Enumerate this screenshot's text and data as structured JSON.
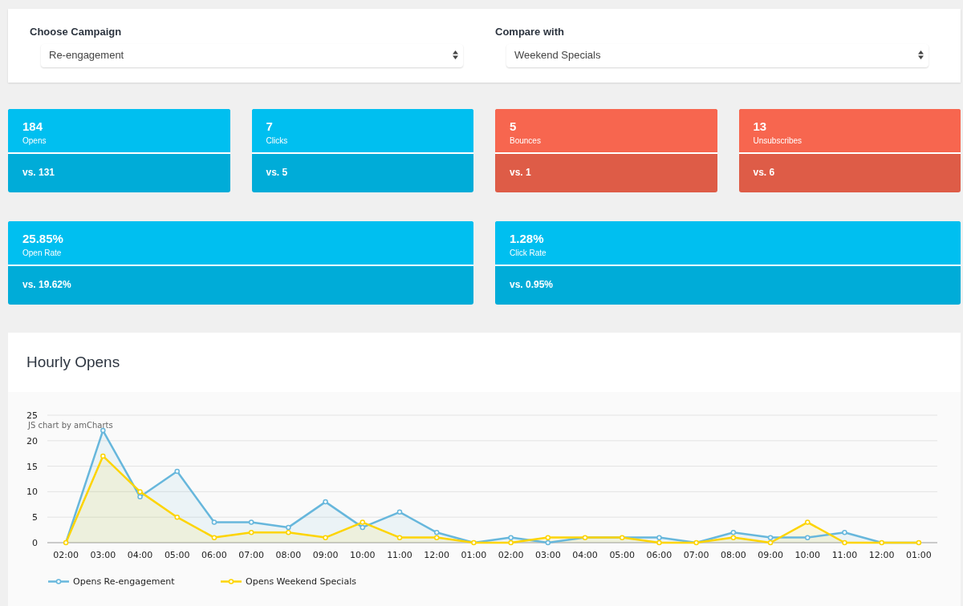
{
  "filters": [
    {
      "label": "Choose Campaign",
      "value": "Re-engagement"
    },
    {
      "label": "Compare with",
      "value": "Weekend Specials"
    }
  ],
  "stat_rows": [
    {
      "cards": [
        {
          "value": "184",
          "label": "Opens",
          "comparison": "vs. 131",
          "color": "#00bff0"
        },
        {
          "value": "7",
          "label": "Clicks",
          "comparison": "vs. 5",
          "color": "#00bff0"
        },
        {
          "value": "5",
          "label": "Bounces",
          "comparison": "vs. 1",
          "color": "#f7664f"
        },
        {
          "value": "13",
          "label": "Unsubscribes",
          "comparison": "vs. 6",
          "color": "#f7664f"
        }
      ]
    },
    {
      "cards": [
        {
          "value": "25.85%",
          "label": "Open Rate",
          "comparison": "vs. 19.62%",
          "color": "#00bff0"
        },
        {
          "value": "1.28%",
          "label": "Click Rate",
          "comparison": "vs. 0.95%",
          "color": "#00bff0"
        }
      ]
    }
  ],
  "chart_panel": {
    "title": "Hourly Opens",
    "credit": "JS chart by amCharts",
    "chart_data": {
      "type": "area",
      "categories": [
        "02:00",
        "03:00",
        "04:00",
        "05:00",
        "06:00",
        "07:00",
        "08:00",
        "09:00",
        "10:00",
        "11:00",
        "12:00",
        "01:00",
        "02:00",
        "03:00",
        "04:00",
        "05:00",
        "06:00",
        "07:00",
        "08:00",
        "09:00",
        "10:00",
        "11:00",
        "12:00",
        "01:00"
      ],
      "series": [
        {
          "name": "Opens Re-engagement",
          "color": "#67b7dc",
          "values": [
            0,
            22,
            9,
            14,
            4,
            4,
            3,
            8,
            3,
            6,
            2,
            0,
            1,
            0,
            1,
            1,
            1,
            0,
            2,
            1,
            1,
            2,
            0,
            0
          ]
        },
        {
          "name": "Opens Weekend Specials",
          "color": "#fdd400",
          "values": [
            0,
            17,
            10,
            5,
            1,
            2,
            2,
            1,
            4,
            1,
            1,
            0,
            0,
            1,
            1,
            1,
            0,
            0,
            1,
            0,
            4,
            0,
            0,
            0
          ]
        }
      ],
      "ylim": [
        0,
        25
      ],
      "yticks": [
        0,
        5,
        10,
        15,
        20,
        25
      ],
      "grid": true,
      "legend": "bottom"
    }
  }
}
